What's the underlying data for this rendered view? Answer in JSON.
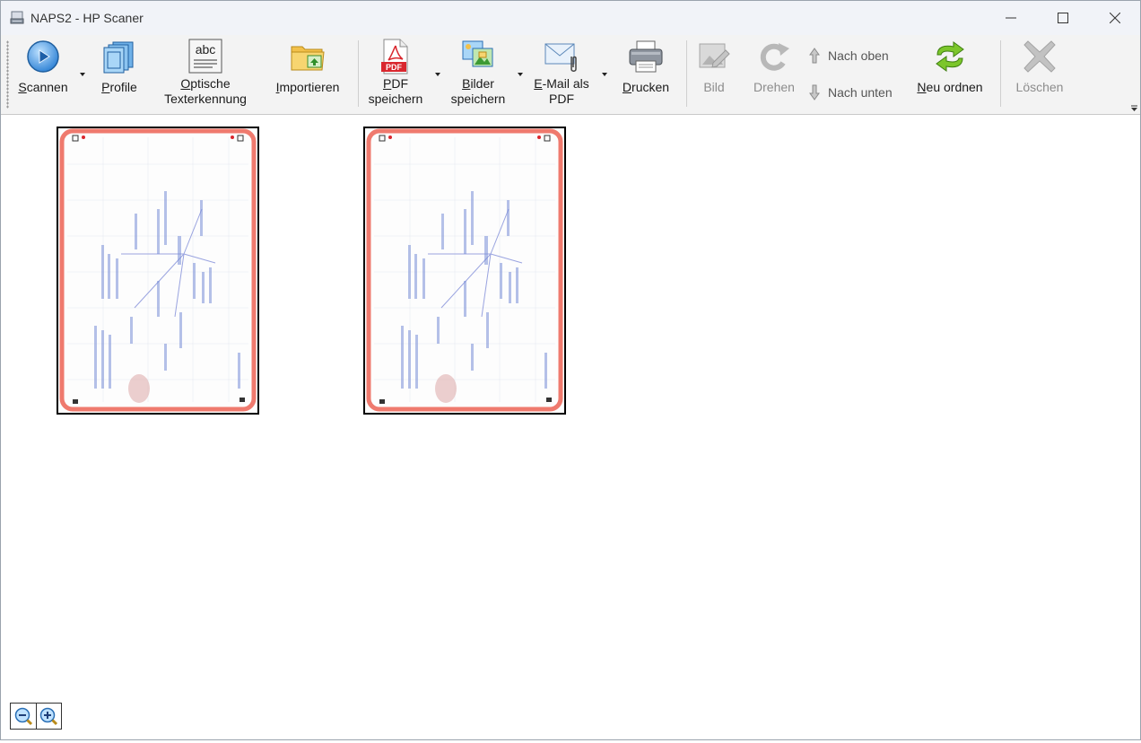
{
  "window": {
    "title": "NAPS2 - HP Scaner",
    "controls": [
      "minimize-icon",
      "maximize-icon",
      "close-icon"
    ]
  },
  "toolbar": {
    "scan": {
      "label": "Scannen",
      "icon": "play-circle-icon",
      "has_dropdown": true
    },
    "profiles": {
      "label": "Profile",
      "icon": "profiles-icon"
    },
    "ocr": {
      "label_line1": "Optische",
      "label_line2": "Texterkennung",
      "icon": "abc-ocr-icon",
      "icon_text": "abc"
    },
    "import": {
      "label": "Importieren",
      "icon": "folder-import-icon"
    },
    "save_pdf": {
      "label_line1": "PDF",
      "label_line2": "speichern",
      "icon": "pdf-file-icon",
      "icon_text": "PDF",
      "has_dropdown": true
    },
    "save_images": {
      "label_line1": "Bilder",
      "label_line2": "speichern",
      "icon": "images-icon",
      "has_dropdown": true
    },
    "email_pdf": {
      "label_line1": "E-Mail als",
      "label_line2": "PDF",
      "icon": "email-attachment-icon",
      "has_dropdown": true
    },
    "print": {
      "label": "Drucken",
      "icon": "printer-icon"
    },
    "image": {
      "label": "Bild",
      "icon": "image-edit-icon",
      "enabled": false
    },
    "rotate": {
      "label": "Drehen",
      "icon": "rotate-icon",
      "enabled": false
    },
    "move_up": {
      "label": "Nach oben",
      "icon": "arrow-up-icon"
    },
    "move_down": {
      "label": "Nach unten",
      "icon": "arrow-down-icon"
    },
    "reorder": {
      "label": "Neu ordnen",
      "icon": "reorder-arrows-icon"
    },
    "delete": {
      "label": "Löschen",
      "icon": "delete-x-icon",
      "enabled": false
    }
  },
  "pages": [
    {
      "label": "",
      "type": "scanned-mindmap-thumbnail"
    },
    {
      "label": "",
      "type": "scanned-mindmap-thumbnail"
    }
  ],
  "zoom": {
    "zoom_out_icon": "zoom-out-icon",
    "zoom_in_icon": "zoom-in-icon"
  },
  "colors": {
    "accent_blue": "#2a7fd4",
    "reorder_green": "#6cbf1f",
    "disabled_gray": "#8c8c8c",
    "pdf_red": "#d9272e",
    "thumb_border_red": "#ef7a6e",
    "handwriting_blue": "#7a8fd8"
  }
}
